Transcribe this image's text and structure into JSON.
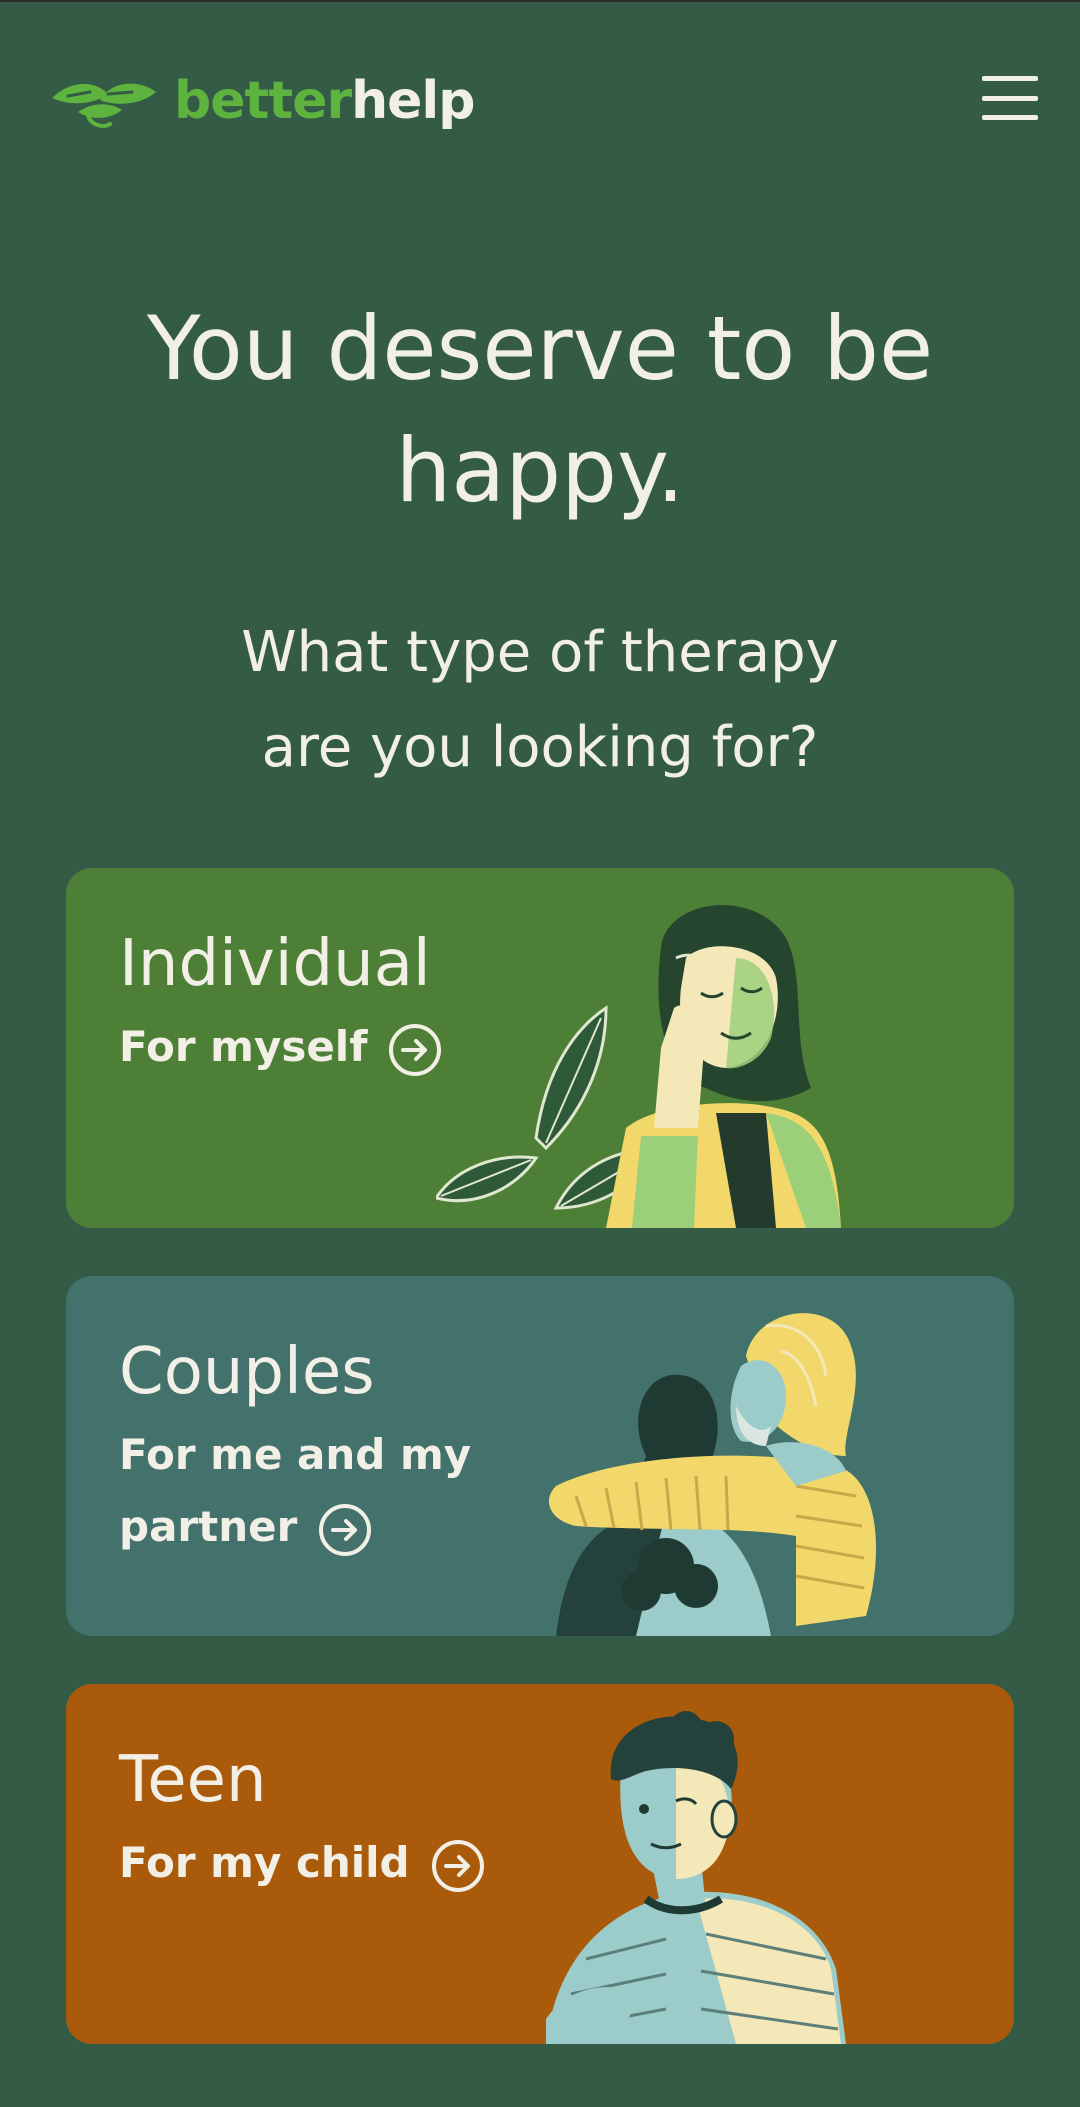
{
  "brand": {
    "name_part1": "better",
    "name_part2": "help"
  },
  "hero": {
    "title_line1": "You deserve to be",
    "title_line2": "happy.",
    "question_line1": "What type of therapy",
    "question_line2": "are you looking for?"
  },
  "cards": [
    {
      "title": "Individual",
      "subtitle_line1": "For myself",
      "subtitle_line2": "",
      "color": "#4d7f36"
    },
    {
      "title": "Couples",
      "subtitle_line1": "For me and my",
      "subtitle_line2": "partner",
      "color": "#43716b"
    },
    {
      "title": "Teen",
      "subtitle_line1": "For my child",
      "subtitle_line2": "",
      "color": "#a95a0b"
    }
  ],
  "colors": {
    "background": "#335b46",
    "brand_green": "#5eb33e",
    "text_light": "#f2f0e6"
  },
  "icons": {
    "menu": "hamburger-menu-icon",
    "arrow": "arrow-right-circle-icon",
    "logo": "leaf-hands-logo-icon"
  }
}
